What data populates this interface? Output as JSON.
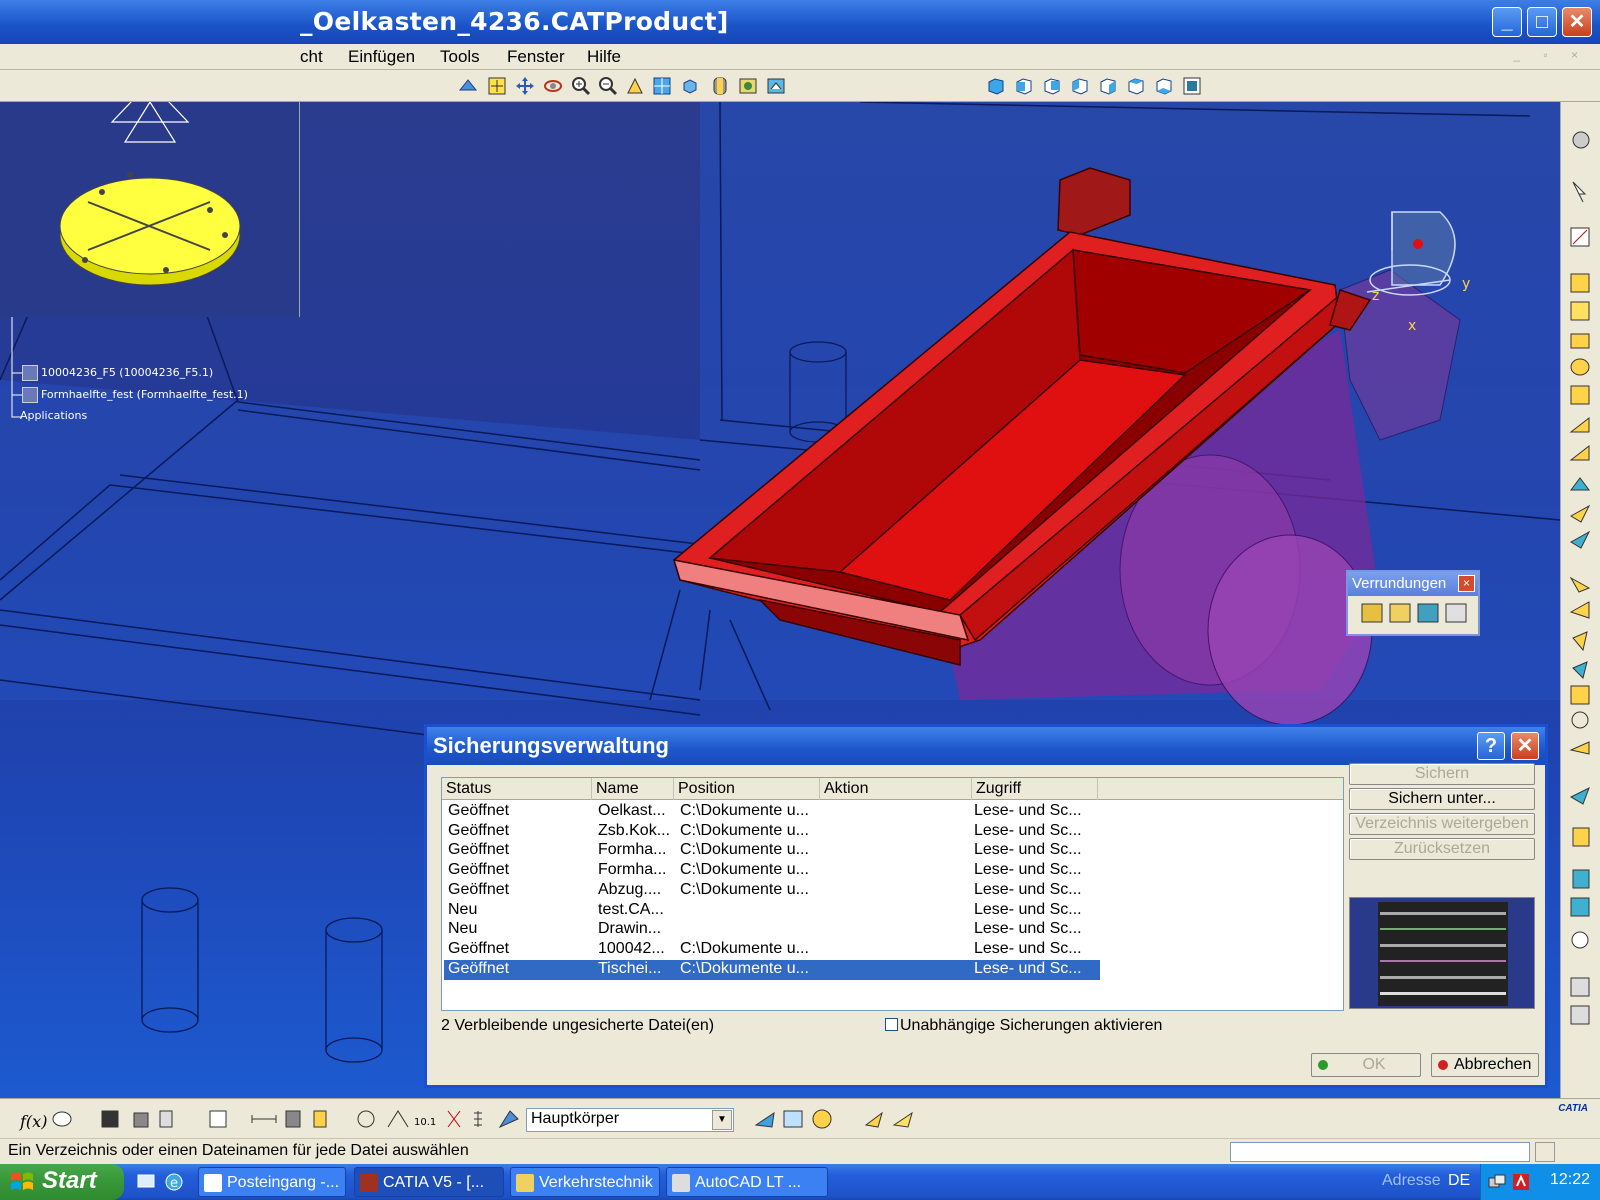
{
  "window": {
    "title": "_Oelkasten_4236.CATProduct]",
    "minimize": "_",
    "maximize": "□",
    "close": "✕"
  },
  "menu": [
    "cht",
    "Einfügen",
    "Tools",
    "Fenster",
    "Hilfe"
  ],
  "tree": [
    {
      "label": "10004236_F5 (10004236_F5.1)"
    },
    {
      "label": "Formhaelfte_fest (Formhaelfte_fest.1)"
    },
    {
      "label": "Applications"
    }
  ],
  "viewport": {
    "axis_labels": [
      "z",
      "y",
      "x"
    ]
  },
  "verrundungen": {
    "title": "Verrundungen",
    "close": "×"
  },
  "dialog": {
    "title": "Sicherungsverwaltung",
    "help": "?",
    "close": "✕",
    "columns": [
      "Status",
      "Name",
      "Position",
      "Aktion",
      "Zugriff"
    ],
    "rows": [
      {
        "status": "Geöffnet",
        "name": "Oelkast...",
        "position": "C:\\Dokumente u...",
        "aktion": "",
        "zugriff": "Lese- und Sc..."
      },
      {
        "status": "Geöffnet",
        "name": "Zsb.Kok...",
        "position": "C:\\Dokumente u...",
        "aktion": "",
        "zugriff": "Lese- und Sc..."
      },
      {
        "status": "Geöffnet",
        "name": "Formha...",
        "position": "C:\\Dokumente u...",
        "aktion": "",
        "zugriff": "Lese- und Sc..."
      },
      {
        "status": "Geöffnet",
        "name": "Formha...",
        "position": "C:\\Dokumente u...",
        "aktion": "",
        "zugriff": "Lese- und Sc..."
      },
      {
        "status": "Geöffnet",
        "name": "Abzug....",
        "position": "C:\\Dokumente u...",
        "aktion": "",
        "zugriff": "Lese- und Sc..."
      },
      {
        "status": "Neu",
        "name": "test.CA...",
        "position": "",
        "aktion": "",
        "zugriff": "Lese- und Sc..."
      },
      {
        "status": "Neu",
        "name": "Drawin...",
        "position": "",
        "aktion": "",
        "zugriff": "Lese- und Sc..."
      },
      {
        "status": "Geöffnet",
        "name": "100042...",
        "position": "C:\\Dokumente u...",
        "aktion": "",
        "zugriff": "Lese- und Sc..."
      },
      {
        "status": "Geöffnet",
        "name": "Tischei...",
        "position": "C:\\Dokumente u...",
        "aktion": "",
        "zugriff": "Lese- und Sc...",
        "selected": true
      }
    ],
    "buttons": {
      "save": "Sichern",
      "save_as": "Sichern unter...",
      "propagate": "Verzeichnis weitergeben",
      "reset": "Zurücksetzen",
      "ok": "OK",
      "cancel": "Abbrechen"
    },
    "remaining": "2 Verbleibende ungesicherte Datei(en)",
    "checkbox_label": "Unabhängige Sicherungen aktivieren"
  },
  "bottom_toolbar": {
    "body_select": "Hauptkörper",
    "logo": "CATIA"
  },
  "status": {
    "text": "Ein Verzeichnis oder einen Dateinamen für jede Datei auswählen"
  },
  "taskbar": {
    "start": "Start",
    "tasks": [
      "Posteingang -...",
      "CATIA V5 - [...",
      "Verkehrstechnik",
      "AutoCAD LT ..."
    ],
    "address": "Adresse",
    "lang": "DE",
    "time": "12:22"
  },
  "colors": {
    "accent": "#1c4fd0",
    "part_red": "#cc0000",
    "viewport_bg": "#2043b0",
    "selection": "#316ac5"
  }
}
